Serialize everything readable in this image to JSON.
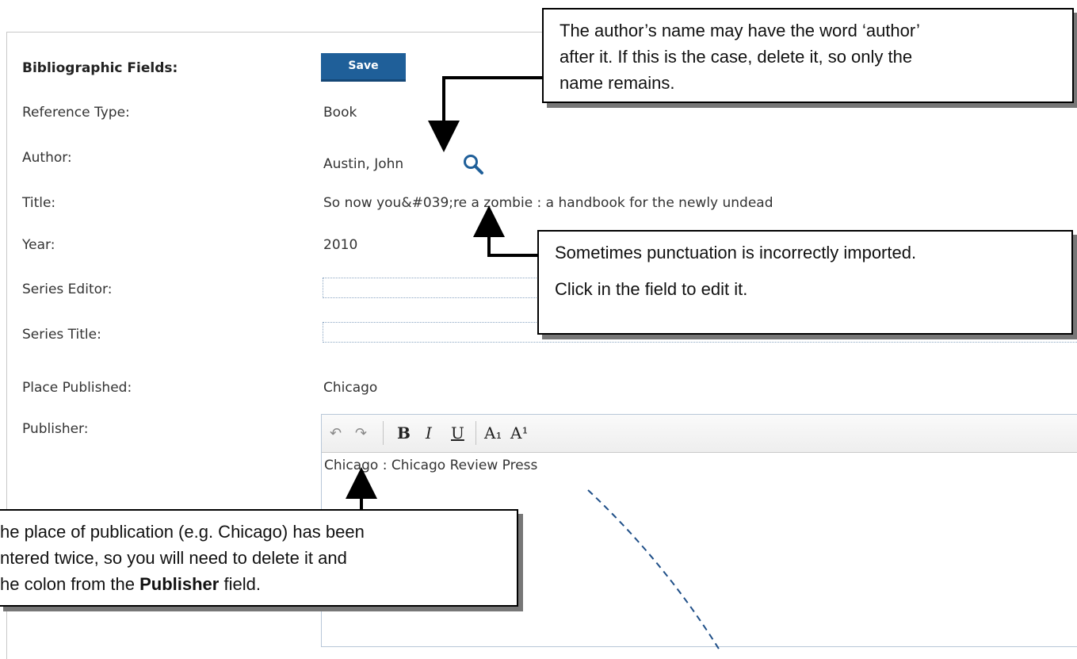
{
  "fields": {
    "section_title": "Bibliographic Fields:",
    "save_label": "Save",
    "reference_type_label": "Reference Type:",
    "reference_type_value": "Book",
    "author_label": "Author:",
    "author_value": "Austin, John",
    "title_label": "Title:",
    "title_value": "So now you&#039;re a zombie : a handbook for the newly undead",
    "year_label": "Year:",
    "year_value": "2010",
    "series_editor_label": "Series Editor:",
    "series_editor_value": "",
    "series_title_label": "Series Title:",
    "series_title_value": "",
    "place_published_label": "Place Published:",
    "place_published_value": "Chicago",
    "publisher_label": "Publisher:",
    "publisher_value": "Chicago : Chicago Review Press"
  },
  "toolbar": {
    "undo_icon": "undo-icon",
    "redo_icon": "redo-icon",
    "bold": "B",
    "italic": "I",
    "underline": "U",
    "subscript": "A₁",
    "superscript": "A¹"
  },
  "callouts": {
    "author_line1": "The author’s name may have the word ‘author’",
    "author_line2": "after it. If this is the case, delete it, so only the",
    "author_line3": "name remains.",
    "punct_line1": "Sometimes punctuation is incorrectly imported.",
    "punct_line2": "Click in the field to edit it.",
    "place_line1": "he place of publication (e.g. Chicago) has been",
    "place_line2": "ntered twice, so you will need to delete it and",
    "place_line3_a": "he colon from the ",
    "place_line3_bold": "Publisher",
    "place_line3_b": " field."
  },
  "colors": {
    "save_button": "#1f5f99",
    "search_icon": "#1f5f99",
    "callout_border": "#000000"
  }
}
